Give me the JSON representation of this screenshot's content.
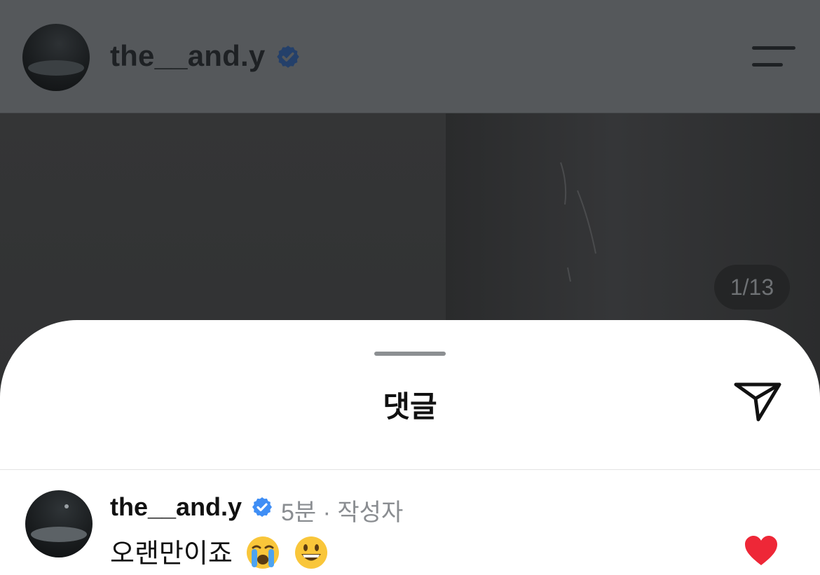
{
  "header": {
    "username": "the__and.y",
    "verified_icon": "verified-badge-icon",
    "menu_icon": "menu-icon"
  },
  "photo": {
    "page_counter": "1/13"
  },
  "sheet": {
    "title": "댓글",
    "share_icon": "send-icon"
  },
  "comment": {
    "username": "the__and.y",
    "time": "5분",
    "separator": "·",
    "author_tag": "작성자",
    "meta": "5분 · 작성자",
    "text": "오랜만이죠",
    "emojis": [
      "crying-face-emoji",
      "smiling-face-emoji"
    ],
    "liked": true
  },
  "colors": {
    "verified": "#3f8ef5",
    "heart": "#ee2737",
    "meta_text": "#8a8d91"
  }
}
